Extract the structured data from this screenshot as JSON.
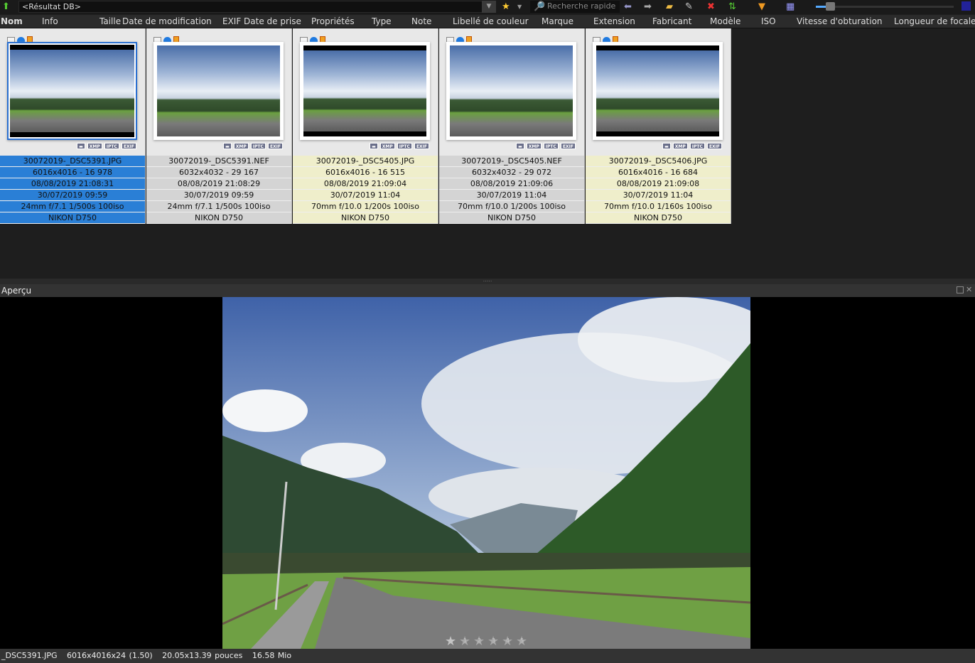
{
  "toolbar": {
    "path": "<Résultat DB>",
    "search_placeholder": "Recherche rapide"
  },
  "columns": [
    "Nom",
    "Info",
    "Taille",
    "Date de modification",
    "EXIF Date de prise",
    "Propriétés",
    "Type",
    "Note",
    "Libellé de couleur",
    "Marque",
    "Extension",
    "Fabricant",
    "Modèle",
    "ISO",
    "Vitesse d'obturation",
    "Longueur de focale"
  ],
  "files": [
    {
      "name": "30072019-_DSC5391.JPG",
      "dims": "6016x4016 - 16 978",
      "modified": "08/08/2019 21:08:31",
      "taken": "30/07/2019 09:59",
      "exif": "24mm f/7.1 1/500s 100iso",
      "camera": "NIKON D750",
      "selected": true
    },
    {
      "name": "30072019-_DSC5391.NEF",
      "dims": "6032x4032 - 29 167",
      "modified": "08/08/2019 21:08:29",
      "taken": "30/07/2019 09:59",
      "exif": "24mm f/7.1 1/500s 100iso",
      "camera": "NIKON D750"
    },
    {
      "name": "30072019-_DSC5405.JPG",
      "dims": "6016x4016 - 16 515",
      "modified": "08/08/2019 21:09:04",
      "taken": "30/07/2019 11:04",
      "exif": "70mm f/10.0 1/200s 100iso",
      "camera": "NIKON D750"
    },
    {
      "name": "30072019-_DSC5405.NEF",
      "dims": "6032x4032 - 29 072",
      "modified": "08/08/2019 21:09:06",
      "taken": "30/07/2019 11:04",
      "exif": "70mm f/10.0 1/200s 100iso",
      "camera": "NIKON D750"
    },
    {
      "name": "30072019-_DSC5406.JPG",
      "dims": "6016x4016 - 16 684",
      "modified": "08/08/2019 21:09:08",
      "taken": "30/07/2019 11:04",
      "exif": "70mm f/10.0 1/160s 100iso",
      "camera": "NIKON D750"
    }
  ],
  "badges": [
    "XMP",
    "IPTC",
    "EXIF"
  ],
  "preview": {
    "title": "Aperçu",
    "rating_labels": [
      "1",
      "2",
      "3",
      "4",
      "5"
    ],
    "rating": 0
  },
  "status": {
    "file": "_DSC5391.JPG",
    "dims": "6016x4016x24 (1.50)",
    "print": "20.05x13.39 pouces",
    "size": "16.58 Mio"
  }
}
